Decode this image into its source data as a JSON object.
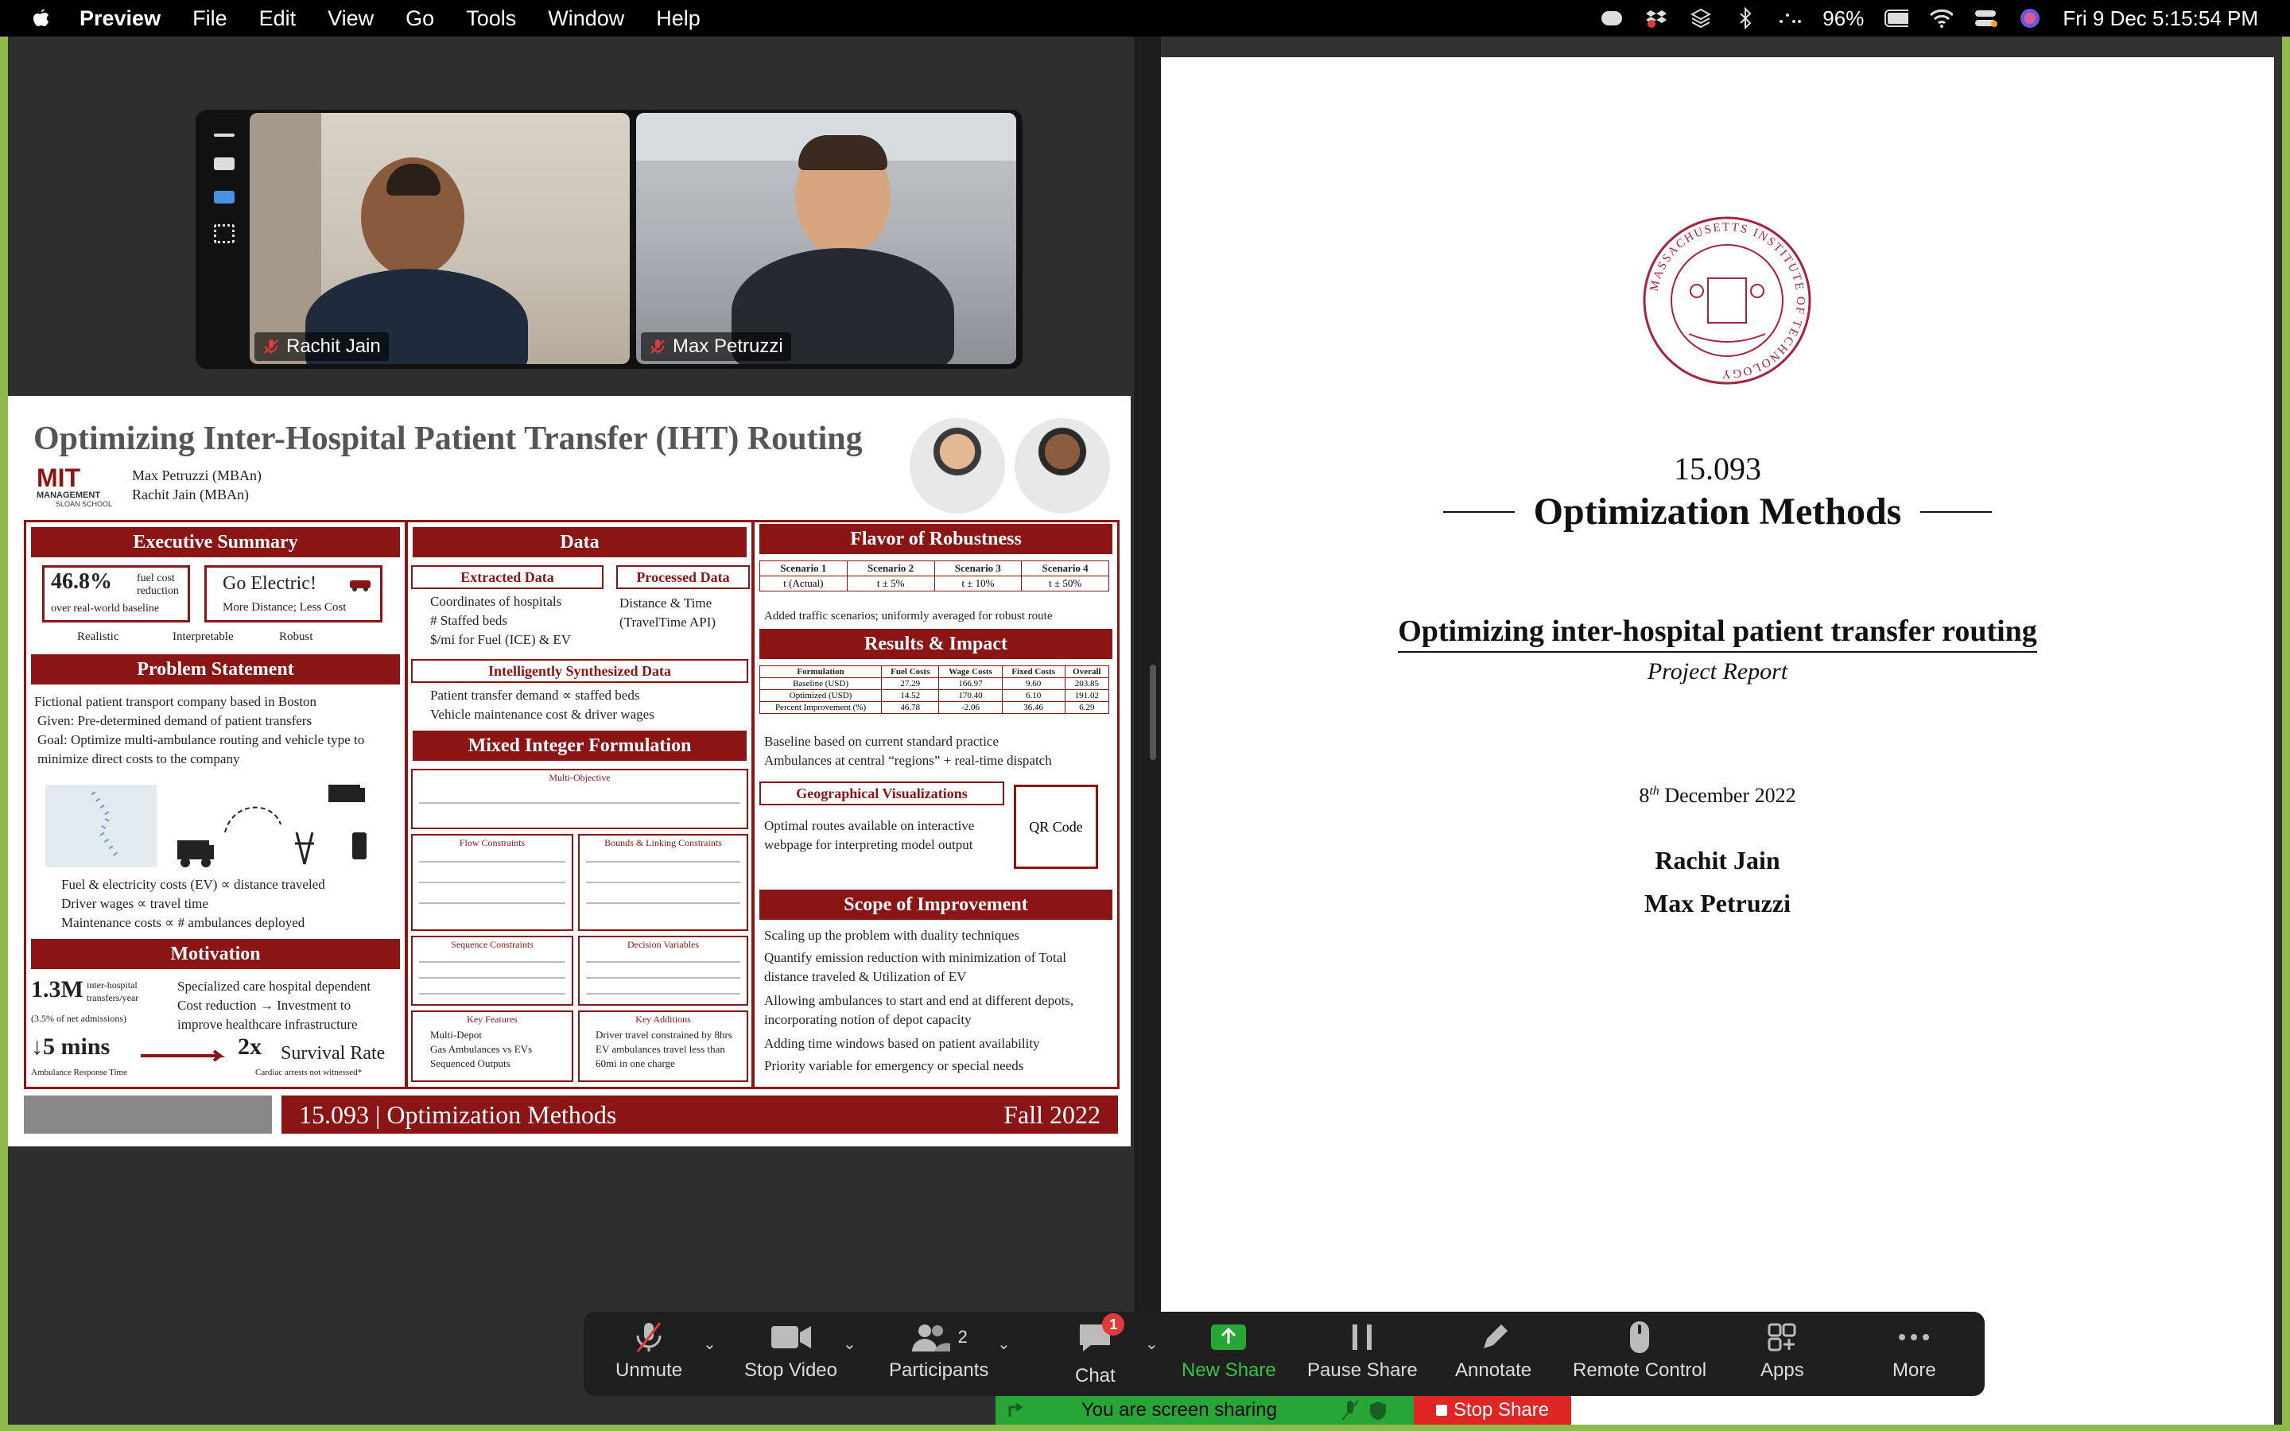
{
  "menubar": {
    "app": "Preview",
    "items": [
      "File",
      "Edit",
      "View",
      "Go",
      "Tools",
      "Window",
      "Help"
    ],
    "battery": "96%",
    "datetime": "Fri 9 Dec  5:15:54 PM"
  },
  "video": {
    "participants": [
      {
        "name": "Rachit Jain"
      },
      {
        "name": "Max Petruzzi"
      }
    ]
  },
  "poster": {
    "title": "Optimizing Inter-Hospital Patient Transfer (IHT) Routing",
    "authors": [
      "Max Petruzzi (MBAn)",
      "Rachit Jain (MBAn)"
    ],
    "logo_text": "MIT MANAGEMENT SLOAN SCHOOL",
    "exec_summary": {
      "heading": "Executive Summary",
      "stat_value": "46.8%",
      "stat_text1": "fuel cost",
      "stat_text2": "reduction",
      "stat_text3": "over real-world baseline",
      "electric_title": "Go Electric!",
      "electric_sub": "More Distance; Less Cost",
      "tags": [
        "Realistic",
        "Interpretable",
        "Robust"
      ]
    },
    "problem": {
      "heading": "Problem Statement",
      "intro": "Fictional patient transport company based in Boston",
      "given": "Given: Pre-determined demand of patient transfers",
      "goal": "Goal: Optimize multi-ambulance routing and vehicle type to minimize direct costs to the company",
      "costs": [
        "Fuel & electricity costs (EV) ∝ distance traveled",
        "Driver wages ∝ travel time",
        "Maintenance costs ∝ # ambulances deployed"
      ]
    },
    "motivation": {
      "heading": "Motivation",
      "big1": "1.3M",
      "big1_text": "inter-hospital transfers/year",
      "big1_sub": "(3.5% of net admissions)",
      "point1": "Specialized care hospital dependent",
      "point2": "Cost reduction → Investment to improve healthcare infrastructure",
      "big2": "↓5 mins",
      "big2_sub": "Ambulance Response Time",
      "big3": "2x",
      "big3_text": "Survival Rate",
      "big3_sub": "Cardiac arrests not witnessed*"
    },
    "data_col": {
      "heading": "Data",
      "extracted": "Extracted Data",
      "extracted_items": [
        "Coordinates of hospitals",
        "# Staffed beds",
        "$/mi for Fuel (ICE) & EV"
      ],
      "processed": "Processed Data",
      "processed_items": [
        "Distance & Time (TravelTime API)"
      ],
      "synth": "Intelligently Synthesized Data",
      "synth_items": [
        "Patient transfer demand ∝ staffed beds",
        "Vehicle maintenance cost & driver wages"
      ],
      "mip": "Mixed Integer Formulation",
      "multi_obj": "Multi-Objective",
      "flow": "Flow Constraints",
      "bounds": "Bounds & Linking Constraints",
      "sequence": "Sequence Constraints",
      "decision": "Decision Variables",
      "key_features": "Key Features",
      "key_features_items": [
        "Multi-Depot",
        "Gas Ambulances vs EVs",
        "Sequenced Outputs"
      ],
      "key_additions": "Key Additions",
      "key_additions_items": [
        "Driver travel constrained by 8hrs",
        "EV ambulances travel less than 60mi in one charge"
      ]
    },
    "right_col": {
      "flavor": "Flavor of Robustness",
      "scenarios": [
        "Scenario 1",
        "Scenario 2",
        "Scenario 3",
        "Scenario 4"
      ],
      "scenario_vals": [
        "t (Actual)",
        "t ± 5%",
        "t ± 10%",
        "t ± 50%"
      ],
      "flavor_note": "Added traffic scenarios; uniformly averaged for robust route",
      "results": "Results & Impact",
      "res_cols": [
        "Formulation",
        "Fuel Costs",
        "Wage Costs",
        "Fixed Costs",
        "Overall"
      ],
      "res_rows": [
        [
          "Baseline (USD)",
          "27.29",
          "166.97",
          "9.60",
          "203.85"
        ],
        [
          "Optimized (USD)",
          "14.52",
          "170.40",
          "6.10",
          "191.02"
        ],
        [
          "Percent Improvement (%)",
          "46.78",
          "-2.06",
          "36.46",
          "6.29"
        ]
      ],
      "res_notes": [
        "Baseline based on current standard practice",
        "Ambulances at central “regions” + real-time dispatch"
      ],
      "geo": "Geographical Visualizations",
      "geo_text": "Optimal routes available on interactive webpage for interpreting model output",
      "qr": "QR Code",
      "scope": "Scope of Improvement",
      "scope_items": [
        "Scaling up the problem with duality techniques",
        "Quantify emission reduction with minimization of Total distance traveled & Utilization of EV",
        "Allowing ambulances to start and end at different depots, incorporating notion of depot capacity",
        "Adding time windows based on patient availability",
        "Priority variable for emergency or special needs"
      ]
    },
    "footer_course": "15.093 | Optimization Methods",
    "footer_term": "Fall 2022"
  },
  "report": {
    "seal_text": "MASSACHUSETTS INSTITUTE OF TECHNOLOGY",
    "course_no": "15.093",
    "course_name": "Optimization Methods",
    "title": "Optimizing inter-hospital patient transfer routing",
    "subtitle": "Project Report",
    "date_day": "8",
    "date_suffix": "th",
    "date_rest": " December 2022",
    "author1": "Rachit Jain",
    "author2": "Max Petruzzi"
  },
  "toolbar": {
    "unmute": "Unmute",
    "stop_video": "Stop Video",
    "participants": "Participants",
    "participants_count": "2",
    "chat": "Chat",
    "chat_badge": "1",
    "new_share": "New Share",
    "pause_share": "Pause Share",
    "annotate": "Annotate",
    "remote_control": "Remote Control",
    "apps": "Apps",
    "more": "More"
  },
  "sharebar": {
    "text": "You are screen sharing",
    "stop": "Stop Share"
  },
  "colors": {
    "crimson": "#8b1414",
    "zoom_green": "#27a637",
    "stop_red": "#e02525"
  }
}
